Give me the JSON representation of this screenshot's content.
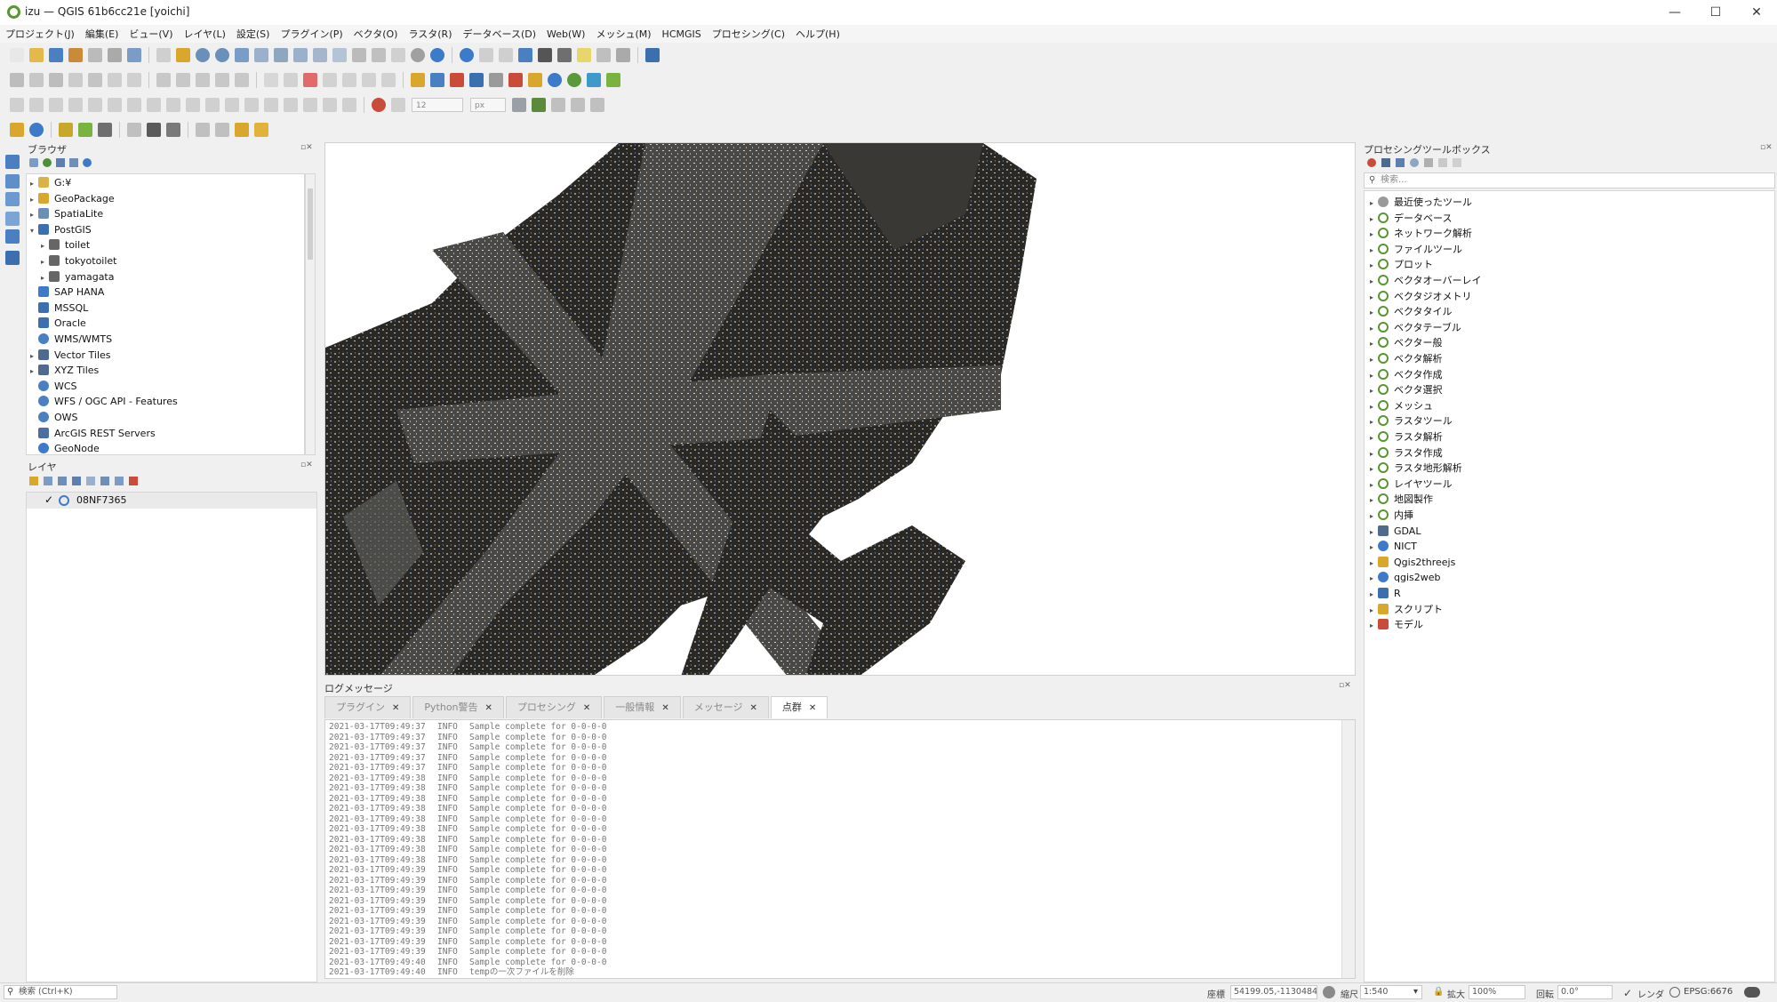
{
  "window": {
    "title": "izu — QGIS 61b6cc21e [yoichi]",
    "controls": [
      "—",
      "☐",
      "✕"
    ]
  },
  "menu": [
    "プロジェクト(J)",
    "編集(E)",
    "ビュー(V)",
    "レイヤ(L)",
    "設定(S)",
    "プラグイン(P)",
    "ベクタ(O)",
    "ラスタ(R)",
    "データベース(D)",
    "Web(W)",
    "メッシュ(M)",
    "HCMGIS",
    "プロセシング(C)",
    "ヘルプ(H)"
  ],
  "toolbar": {
    "font_size": "12",
    "font_unit": "px"
  },
  "browser": {
    "title": "ブラウザ",
    "items": [
      {
        "label": "G:¥",
        "icon": "folder-icon",
        "expander": "▸",
        "indent": 0
      },
      {
        "label": "GeoPackage",
        "icon": "geopackage-icon",
        "expander": "▸",
        "indent": 0
      },
      {
        "label": "SpatiaLite",
        "icon": "spatialite-icon",
        "expander": "▸",
        "indent": 0
      },
      {
        "label": "PostGIS",
        "icon": "postgis-icon",
        "expander": "▾",
        "indent": 0
      },
      {
        "label": "toilet",
        "icon": "connection-icon",
        "expander": "▸",
        "indent": 1
      },
      {
        "label": "tokyotoilet",
        "icon": "connection-icon",
        "expander": "▸",
        "indent": 1
      },
      {
        "label": "yamagata",
        "icon": "connection-icon",
        "expander": "▸",
        "indent": 1
      },
      {
        "label": "SAP HANA",
        "icon": "sap-hana-icon",
        "expander": "",
        "indent": 0
      },
      {
        "label": "MSSQL",
        "icon": "mssql-icon",
        "expander": "",
        "indent": 0
      },
      {
        "label": "Oracle",
        "icon": "oracle-icon",
        "expander": "",
        "indent": 0
      },
      {
        "label": "WMS/WMTS",
        "icon": "globe-icon",
        "expander": "",
        "indent": 0
      },
      {
        "label": "Vector Tiles",
        "icon": "grid-icon",
        "expander": "▸",
        "indent": 0
      },
      {
        "label": "XYZ Tiles",
        "icon": "grid-icon",
        "expander": "▸",
        "indent": 0
      },
      {
        "label": "WCS",
        "icon": "globe-icon",
        "expander": "",
        "indent": 0
      },
      {
        "label": "WFS / OGC API - Features",
        "icon": "globe-icon",
        "expander": "",
        "indent": 0
      },
      {
        "label": "OWS",
        "icon": "globe-icon",
        "expander": "",
        "indent": 0
      },
      {
        "label": "ArcGIS REST Servers",
        "icon": "arcgis-icon",
        "expander": "",
        "indent": 0
      },
      {
        "label": "GeoNode",
        "icon": "geonode-icon",
        "expander": "",
        "indent": 0
      }
    ]
  },
  "layers": {
    "title": "レイヤ",
    "items": [
      {
        "label": "08NF7365",
        "checked": "✓"
      }
    ]
  },
  "log": {
    "title": "ログメッセージ",
    "tabs": [
      {
        "label": "プラグイン",
        "close": "✕"
      },
      {
        "label": "Python警告",
        "close": "✕"
      },
      {
        "label": "プロセシング",
        "close": "✕"
      },
      {
        "label": "一般情報",
        "close": "✕"
      },
      {
        "label": "メッセージ",
        "close": "✕"
      },
      {
        "label": "点群",
        "close": "✕",
        "active": true
      }
    ],
    "lines": [
      {
        "time": "2021-03-17T09:49:37",
        "level": "INFO",
        "msg": "Sample complete for 0-0-0-0"
      },
      {
        "time": "2021-03-17T09:49:37",
        "level": "INFO",
        "msg": "Sample complete for 0-0-0-0"
      },
      {
        "time": "2021-03-17T09:49:37",
        "level": "INFO",
        "msg": "Sample complete for 0-0-0-0"
      },
      {
        "time": "2021-03-17T09:49:37",
        "level": "INFO",
        "msg": "Sample complete for 0-0-0-0"
      },
      {
        "time": "2021-03-17T09:49:37",
        "level": "INFO",
        "msg": "Sample complete for 0-0-0-0"
      },
      {
        "time": "2021-03-17T09:49:38",
        "level": "INFO",
        "msg": "Sample complete for 0-0-0-0"
      },
      {
        "time": "2021-03-17T09:49:38",
        "level": "INFO",
        "msg": "Sample complete for 0-0-0-0"
      },
      {
        "time": "2021-03-17T09:49:38",
        "level": "INFO",
        "msg": "Sample complete for 0-0-0-0"
      },
      {
        "time": "2021-03-17T09:49:38",
        "level": "INFO",
        "msg": "Sample complete for 0-0-0-0"
      },
      {
        "time": "2021-03-17T09:49:38",
        "level": "INFO",
        "msg": "Sample complete for 0-0-0-0"
      },
      {
        "time": "2021-03-17T09:49:38",
        "level": "INFO",
        "msg": "Sample complete for 0-0-0-0"
      },
      {
        "time": "2021-03-17T09:49:38",
        "level": "INFO",
        "msg": "Sample complete for 0-0-0-0"
      },
      {
        "time": "2021-03-17T09:49:38",
        "level": "INFO",
        "msg": "Sample complete for 0-0-0-0"
      },
      {
        "time": "2021-03-17T09:49:38",
        "level": "INFO",
        "msg": "Sample complete for 0-0-0-0"
      },
      {
        "time": "2021-03-17T09:49:39",
        "level": "INFO",
        "msg": "Sample complete for 0-0-0-0"
      },
      {
        "time": "2021-03-17T09:49:39",
        "level": "INFO",
        "msg": "Sample complete for 0-0-0-0"
      },
      {
        "time": "2021-03-17T09:49:39",
        "level": "INFO",
        "msg": "Sample complete for 0-0-0-0"
      },
      {
        "time": "2021-03-17T09:49:39",
        "level": "INFO",
        "msg": "Sample complete for 0-0-0-0"
      },
      {
        "time": "2021-03-17T09:49:39",
        "level": "INFO",
        "msg": "Sample complete for 0-0-0-0"
      },
      {
        "time": "2021-03-17T09:49:39",
        "level": "INFO",
        "msg": "Sample complete for 0-0-0-0"
      },
      {
        "time": "2021-03-17T09:49:39",
        "level": "INFO",
        "msg": "Sample complete for 0-0-0-0"
      },
      {
        "time": "2021-03-17T09:49:39",
        "level": "INFO",
        "msg": "Sample complete for 0-0-0-0"
      },
      {
        "time": "2021-03-17T09:49:39",
        "level": "INFO",
        "msg": "Sample complete for 0-0-0-0"
      },
      {
        "time": "2021-03-17T09:49:40",
        "level": "INFO",
        "msg": "Sample complete for 0-0-0-0"
      },
      {
        "time": "2021-03-17T09:49:40",
        "level": "INFO",
        "msg": "tempの一次ファイルを削除"
      }
    ]
  },
  "processing": {
    "title": "プロセシングツールボックス",
    "search_placeholder": "検索...",
    "items": [
      {
        "label": "最近使ったツール",
        "icon": "clock-icon"
      },
      {
        "label": "データベース",
        "icon": "qgis-icon"
      },
      {
        "label": "ネットワーク解析",
        "icon": "qgis-icon"
      },
      {
        "label": "ファイルツール",
        "icon": "qgis-icon"
      },
      {
        "label": "プロット",
        "icon": "qgis-icon"
      },
      {
        "label": "ベクタオーバーレイ",
        "icon": "qgis-icon"
      },
      {
        "label": "ベクタジオメトリ",
        "icon": "qgis-icon"
      },
      {
        "label": "ベクタタイル",
        "icon": "qgis-icon"
      },
      {
        "label": "ベクタテーブル",
        "icon": "qgis-icon"
      },
      {
        "label": "ベクター般",
        "icon": "qgis-icon"
      },
      {
        "label": "ベクタ解析",
        "icon": "qgis-icon"
      },
      {
        "label": "ベクタ作成",
        "icon": "qgis-icon"
      },
      {
        "label": "ベクタ選択",
        "icon": "qgis-icon"
      },
      {
        "label": "メッシュ",
        "icon": "qgis-icon"
      },
      {
        "label": "ラスタツール",
        "icon": "qgis-icon"
      },
      {
        "label": "ラスタ解析",
        "icon": "qgis-icon"
      },
      {
        "label": "ラスタ作成",
        "icon": "qgis-icon"
      },
      {
        "label": "ラスタ地形解析",
        "icon": "qgis-icon"
      },
      {
        "label": "レイヤツール",
        "icon": "qgis-icon"
      },
      {
        "label": "地図製作",
        "icon": "qgis-icon"
      },
      {
        "label": "内挿",
        "icon": "qgis-icon"
      },
      {
        "label": "GDAL",
        "icon": "gdal-icon"
      },
      {
        "label": "NICT",
        "icon": "gear-icon"
      },
      {
        "label": "Qgis2threejs",
        "icon": "threejs-icon"
      },
      {
        "label": "qgis2web",
        "icon": "gear-icon"
      },
      {
        "label": "R",
        "icon": "r-icon"
      },
      {
        "label": "スクリプト",
        "icon": "python-icon"
      },
      {
        "label": "モデル",
        "icon": "model-icon"
      }
    ]
  },
  "statusbar": {
    "search_placeholder": "検索 (Ctrl+K)",
    "coord_label": "座標",
    "coord_value": "54199.05,-11304845",
    "scale_label": "縮尺",
    "scale_value": "1:540",
    "magnifier_label": "拡大",
    "magnifier_value": "100%",
    "rotation_label": "回転",
    "rotation_value": "0.0°",
    "render_label": "レンダ",
    "crs": "EPSG:6676"
  },
  "colors": {
    "qgis_green": "#589632",
    "accent_blue": "#3d7ac9"
  }
}
